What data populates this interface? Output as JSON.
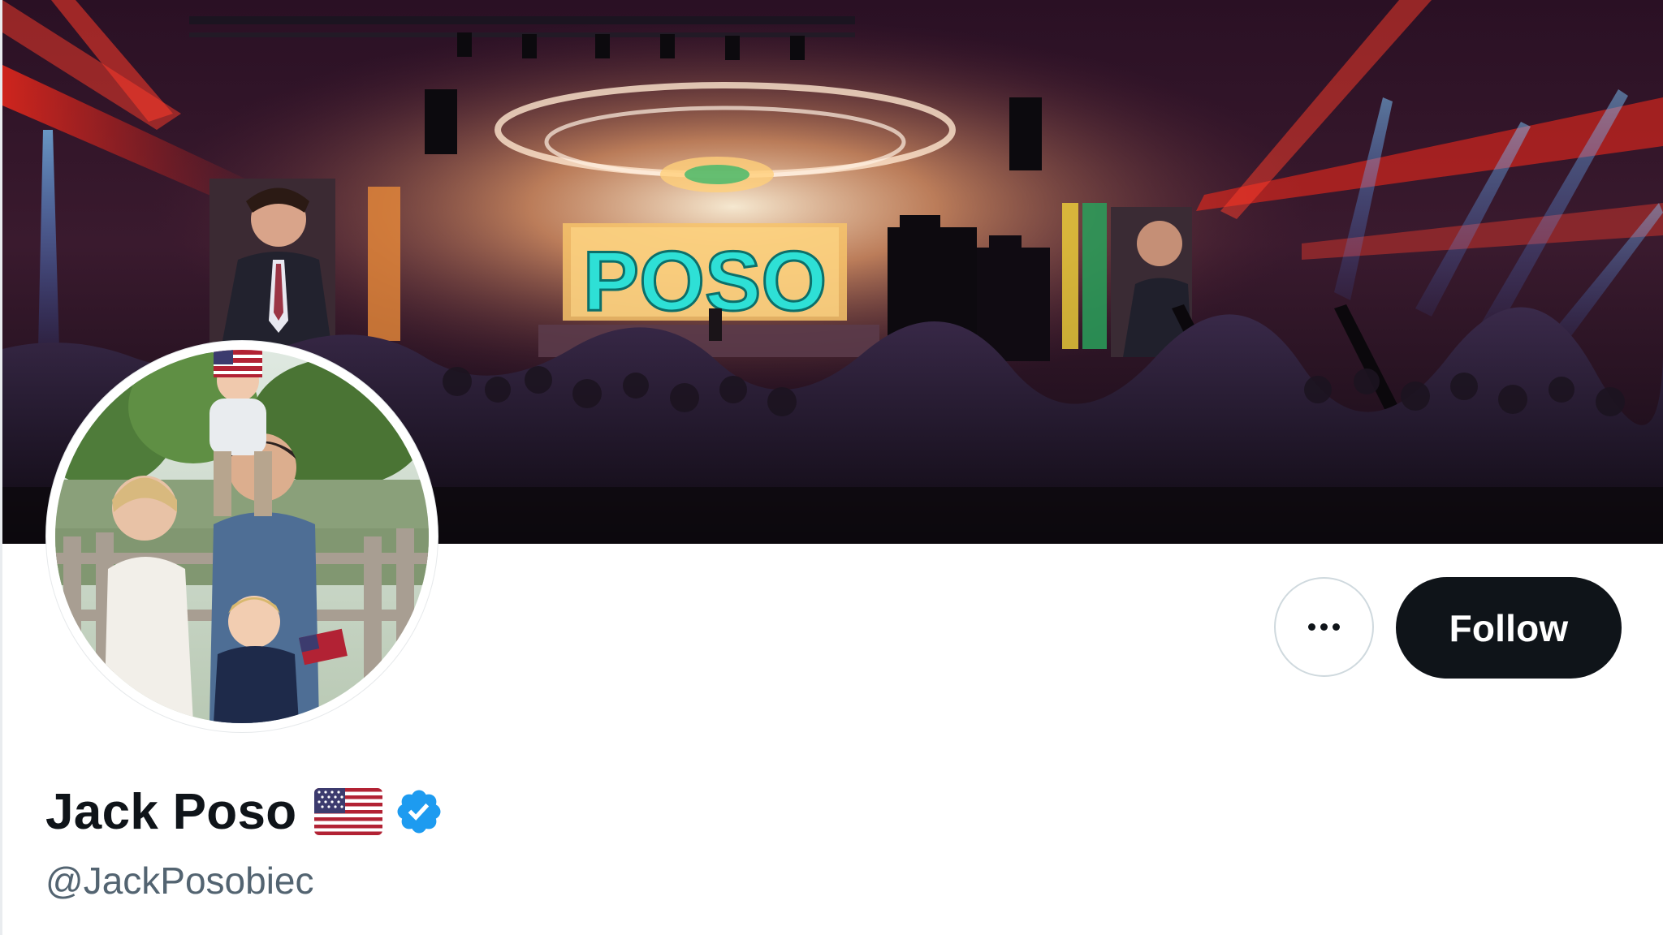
{
  "profile": {
    "display_name": "Jack Poso",
    "name_emoji": "us-flag-emoji",
    "verified_badge": "verified-badge-icon",
    "handle": "@JackPosobiec"
  },
  "banner": {
    "stage_screen_text": "POSO"
  },
  "actions": {
    "more_icon": "more-horizontal-icon",
    "follow_label": "Follow"
  },
  "colors": {
    "follow_button_bg": "#0f1419",
    "follow_button_text": "#ffffff",
    "handle_text": "#536471",
    "verified_blue": "#1d9bf0",
    "name_text": "#0f1419"
  }
}
